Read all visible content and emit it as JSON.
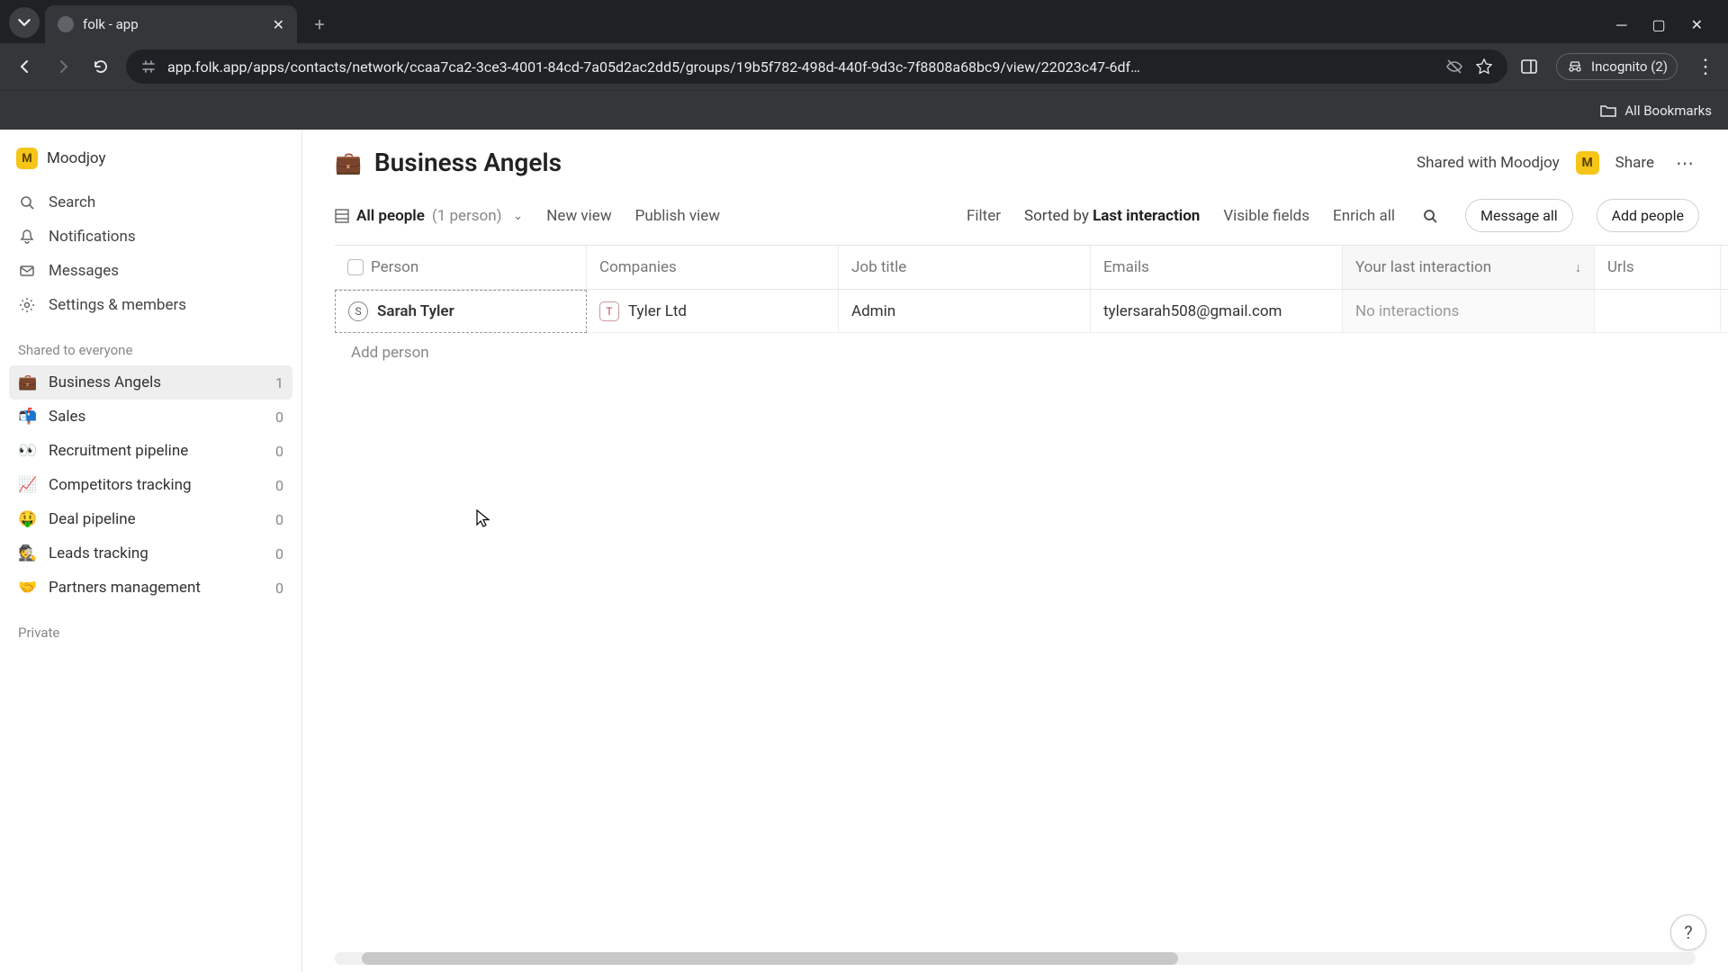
{
  "browser": {
    "tab_title": "folk - app",
    "url": "app.folk.app/apps/contacts/network/ccaa7ca2-3ce3-4001-84cd-7a05d2ac2dd5/groups/19b5f782-498d-440f-9d3c-7f8808a68bc9/view/22023c47-6df…",
    "incognito_label": "Incognito (2)",
    "bookmarks_label": "All Bookmarks"
  },
  "sidebar": {
    "workspace": "Moodjoy",
    "workspace_initial": "M",
    "nav": {
      "search": "Search",
      "notifications": "Notifications",
      "messages": "Messages",
      "settings": "Settings & members"
    },
    "section_shared": "Shared to everyone",
    "groups": [
      {
        "emoji": "💼",
        "label": "Business Angels",
        "count": "1",
        "active": true
      },
      {
        "emoji": "📬",
        "label": "Sales",
        "count": "0",
        "active": false
      },
      {
        "emoji": "👀",
        "label": "Recruitment pipeline",
        "count": "0",
        "active": false
      },
      {
        "emoji": "📈",
        "label": "Competitors tracking",
        "count": "0",
        "active": false
      },
      {
        "emoji": "🤑",
        "label": "Deal pipeline",
        "count": "0",
        "active": false
      },
      {
        "emoji": "🕵️",
        "label": "Leads tracking",
        "count": "0",
        "active": false
      },
      {
        "emoji": "🤝",
        "label": "Partners management",
        "count": "0",
        "active": false
      }
    ],
    "section_private": "Private"
  },
  "header": {
    "emoji": "💼",
    "title": "Business Angels",
    "shared_with": "Shared with Moodjoy",
    "shared_initial": "M",
    "share": "Share"
  },
  "toolbar": {
    "view_name": "All people",
    "view_count": "(1 person)",
    "new_view": "New view",
    "publish_view": "Publish view",
    "filter": "Filter",
    "sorted_by_prefix": "Sorted by ",
    "sorted_by_field": "Last interaction",
    "visible_fields": "Visible fields",
    "enrich_all": "Enrich all",
    "message_all": "Message all",
    "add_people": "Add people"
  },
  "table": {
    "columns": {
      "person": "Person",
      "companies": "Companies",
      "job_title": "Job title",
      "emails": "Emails",
      "last_interaction": "Your last interaction",
      "urls": "Urls"
    },
    "rows": [
      {
        "initial": "S",
        "name": "Sarah Tyler",
        "company_initial": "T",
        "company": "Tyler Ltd",
        "job_title": "Admin",
        "email": "tylersarah508@gmail.com",
        "last_interaction": "No interactions",
        "urls": ""
      }
    ],
    "add_person": "Add person"
  },
  "help_label": "?"
}
